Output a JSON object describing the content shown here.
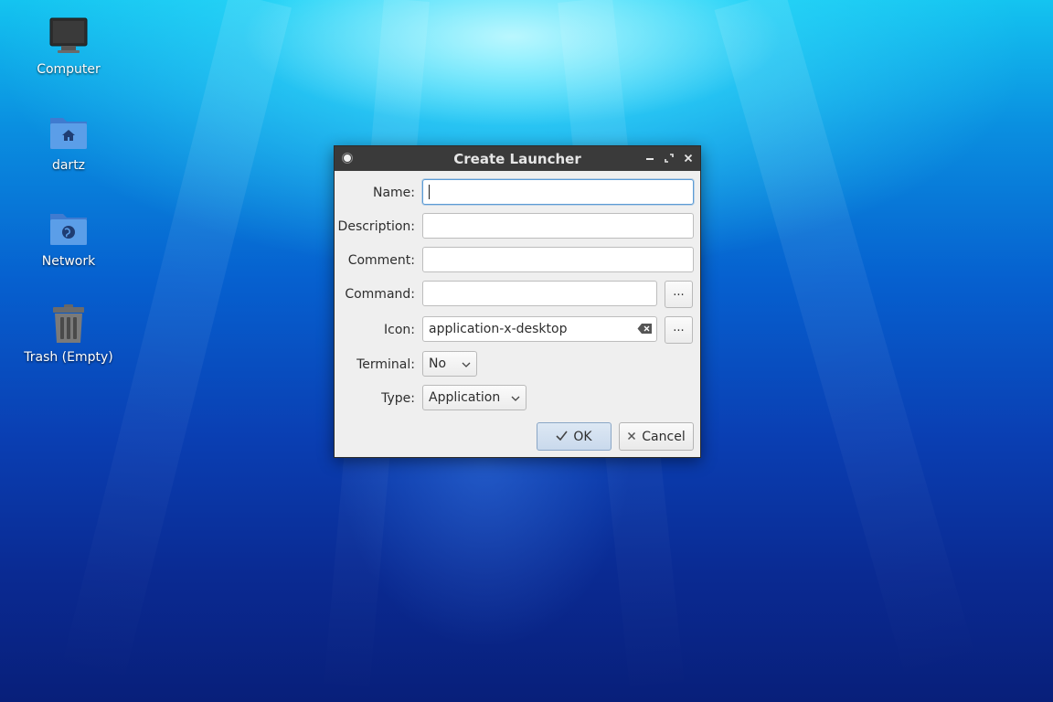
{
  "desktop": {
    "icons": [
      {
        "label": "Computer",
        "icon": "computer-icon"
      },
      {
        "label": "dartz",
        "icon": "home-folder-icon"
      },
      {
        "label": "Network",
        "icon": "network-folder-icon"
      },
      {
        "label": "Trash (Empty)",
        "icon": "trash-icon"
      }
    ]
  },
  "dialog": {
    "title": "Create Launcher",
    "fields": {
      "name": {
        "label": "Name:",
        "value": ""
      },
      "description": {
        "label": "Description:",
        "value": ""
      },
      "comment": {
        "label": "Comment:",
        "value": ""
      },
      "command": {
        "label": "Command:",
        "value": "",
        "browse_label": "..."
      },
      "icon": {
        "label": "Icon:",
        "value": "application-x-desktop",
        "browse_label": "..."
      },
      "terminal": {
        "label": "Terminal:",
        "selected": "No"
      },
      "type": {
        "label": "Type:",
        "selected": "Application"
      }
    },
    "buttons": {
      "ok": "OK",
      "cancel": "Cancel"
    }
  },
  "colors": {
    "titlebar": "#3a3a3a",
    "dialog_bg": "#efefef",
    "focus_border": "#5b9bd5",
    "desktop_top": "#14c4f0",
    "desktop_bottom": "#081f7a"
  }
}
